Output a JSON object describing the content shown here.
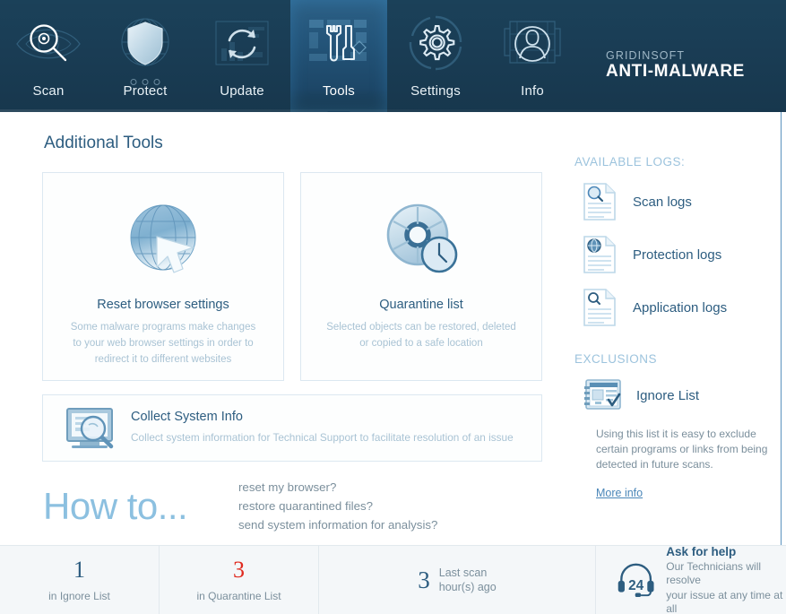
{
  "brand": {
    "line1": "GRIDINSOFT",
    "line2": "ANTI-MALWARE"
  },
  "nav": {
    "items": [
      {
        "label": "Scan",
        "icon": "magnifier-eye-icon",
        "active": false
      },
      {
        "label": "Protect",
        "icon": "shield-icon",
        "active": false
      },
      {
        "label": "Update",
        "icon": "refresh-arrows-icon",
        "active": false
      },
      {
        "label": "Tools",
        "icon": "wrench-screwdriver-icon",
        "active": true
      },
      {
        "label": "Settings",
        "icon": "gear-icon",
        "active": false
      },
      {
        "label": "Info",
        "icon": "user-portrait-icon",
        "active": false
      }
    ]
  },
  "main": {
    "page_title": "Additional Tools",
    "cards": [
      {
        "title": "Reset browser settings",
        "desc": "Some malware programs make changes to your web browser settings in order to redirect it to different websites",
        "icon": "globe-cursor-icon"
      },
      {
        "title": "Quarantine list",
        "desc": "Selected objects can be restored, deleted or copied to a safe location",
        "icon": "disc-clock-icon"
      }
    ],
    "wide_card": {
      "title": "Collect System Info",
      "desc": "Collect system information for Technical Support to facilitate resolution of an issue",
      "icon": "monitor-magnifier-icon"
    },
    "howto": {
      "heading": "How to...",
      "links": [
        "reset my browser?",
        "restore quarantined files?",
        "send system information for analysis?"
      ]
    }
  },
  "sidebar": {
    "logs_heading": "AVAILABLE LOGS:",
    "logs": [
      {
        "label": "Scan logs",
        "icon": "document-magnifier-icon"
      },
      {
        "label": "Protection logs",
        "icon": "document-globe-icon"
      },
      {
        "label": "Application logs",
        "icon": "document-search-icon"
      }
    ],
    "exclusions_heading": "EXCLUSIONS",
    "ignore_list": {
      "label": "Ignore List",
      "icon": "list-check-icon"
    },
    "exclusions_desc": "Using this list it is easy to exclude certain programs or links from being detected in future scans.",
    "more_info": "More info"
  },
  "statusbar": {
    "ignore": {
      "value": "1",
      "label": "in Ignore List",
      "color": "#2d5d80"
    },
    "quarantine": {
      "value": "3",
      "label": "in Quarantine List",
      "color": "#e02b20"
    },
    "last_scan": {
      "value": "3",
      "line1": "Last scan",
      "line2": "hour(s) ago"
    },
    "help": {
      "badge": "24",
      "icon": "headset-icon",
      "title": "Ask for help",
      "line1": "Our Technicians will resolve",
      "line2": "your issue at any time at all"
    }
  },
  "colors": {
    "nav_bg": "#1a3d55",
    "accent": "#2d5d80",
    "muted": "#a9c3d4",
    "alert": "#e02b20",
    "link": "#4a86b8"
  }
}
